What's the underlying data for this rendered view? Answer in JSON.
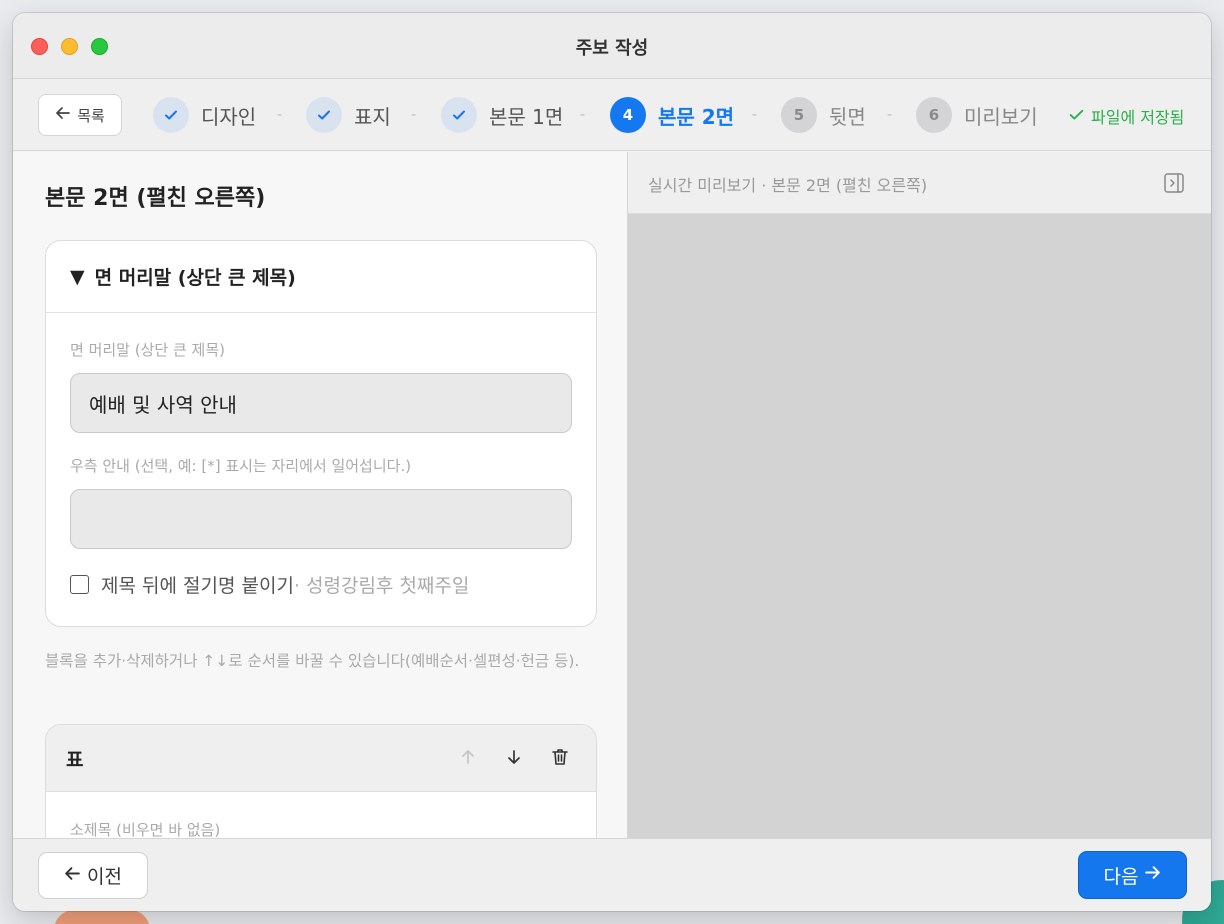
{
  "window": {
    "title": "주보 작성"
  },
  "stepbar": {
    "back_label": "목록",
    "steps": [
      {
        "num": "✓",
        "label": "디자인",
        "state": "done"
      },
      {
        "num": "✓",
        "label": "표지",
        "state": "done"
      },
      {
        "num": "✓",
        "label": "본문 1면",
        "state": "done"
      },
      {
        "num": "4",
        "label": "본문 2면",
        "state": "active"
      },
      {
        "num": "5",
        "label": "뒷면",
        "state": "pending"
      },
      {
        "num": "6",
        "label": "미리보기",
        "state": "pending"
      }
    ],
    "separator": "-",
    "saved_label": "파일에 저장됨"
  },
  "left": {
    "page_title": "본문 2면 (펼친 오른쪽)",
    "section": {
      "toggle": "▼",
      "title": "면 머리말 (상단 큰 제목)",
      "field1_label": "면 머리말 (상단 큰 제목)",
      "field1_value": "예배 및 사역 안내",
      "field2_label": "우측 안내 (선택, 예: [*] 표시는 자리에서 일어섭니다.)",
      "field2_value": "",
      "checkbox_label": "제목 뒤에 절기명 붙이기",
      "checkbox_hint": "· 성령강림후 첫째주일",
      "checkbox_checked": false
    },
    "help_text": "블록을 추가·삭제하거나 ↑↓로 순서를 바꿀 수 있습니다(예배순서·셀편성·헌금 등).",
    "block": {
      "title": "표",
      "subtitle_label": "소제목 (비우면 바 없음)"
    }
  },
  "preview": {
    "title": "실시간 미리보기 · 본문 2면 (펼친 오른쪽)"
  },
  "footer": {
    "prev_label": "이전",
    "next_label": "다음"
  },
  "colors": {
    "accent": "#1478f0",
    "saved": "#2bb04a"
  }
}
